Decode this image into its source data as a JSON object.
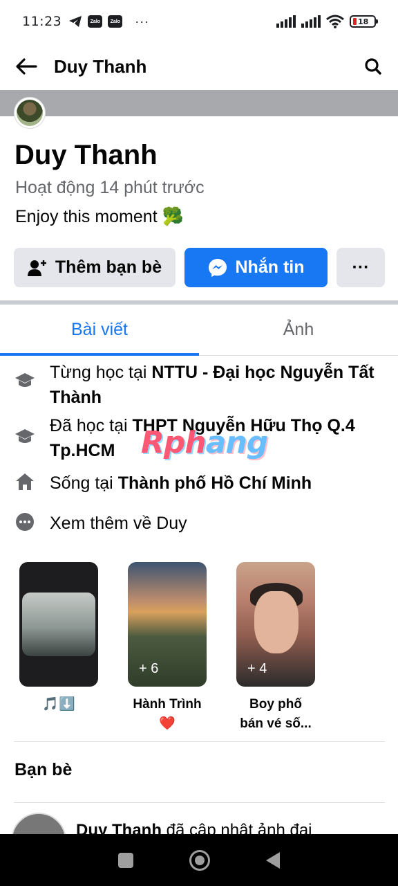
{
  "status_bar": {
    "time": "11:23",
    "zalo1": "Zalo",
    "zalo2": "Zalo",
    "more": "···",
    "battery": "18"
  },
  "top_nav": {
    "title": "Duy Thanh"
  },
  "profile": {
    "name": "Duy Thanh",
    "activity": "Hoạt động 14 phút trước",
    "bio": "Enjoy this moment 🥦"
  },
  "actions": {
    "add_friend": "Thêm bạn bè",
    "message": "Nhắn tin",
    "more": "···"
  },
  "tabs": [
    {
      "label": "Bài viết",
      "active": true
    },
    {
      "label": "Ảnh",
      "active": false
    }
  ],
  "info": {
    "studied1_prefix": "Từng học tại ",
    "studied1_place": "NTTU - Đại học Nguyễn Tất Thành",
    "studied2_prefix": "Đã học tại ",
    "studied2_place": "THPT Nguyễn Hữu Thọ Q.4 Tp.HCM",
    "lives_prefix": "Sống tại ",
    "lives_place": "Thành phố Hồ Chí Minh",
    "see_more": "Xem thêm về Duy"
  },
  "watermark": {
    "part1": "Rph",
    "part2": "ang"
  },
  "highlights": [
    {
      "label": "🎵⬇️",
      "count": ""
    },
    {
      "label": "Hành Trình ❤️",
      "count": "+ 6"
    },
    {
      "label": "Boy phố bán vé số...",
      "count": "+ 4"
    }
  ],
  "friends": {
    "title": "Bạn bè"
  },
  "post_peek": {
    "author": "Duy Thanh",
    "text": " đã cập nhật ảnh đại",
    "dots": "···"
  },
  "colors": {
    "accent": "#1877f2",
    "cover": "#a7a9ad",
    "secondary_text": "#65676b"
  }
}
